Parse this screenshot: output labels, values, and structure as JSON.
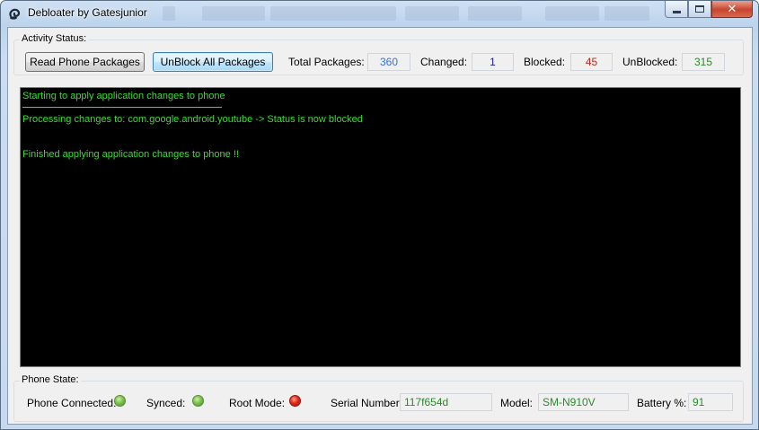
{
  "window": {
    "title": "Debloater by Gatesjunior",
    "controls": {
      "minimize": "minimize",
      "maximize": "maximize",
      "close": "✕"
    }
  },
  "activity": {
    "group_label": "Activity Status:",
    "read_button": "Read Phone Packages",
    "unblock_button": "UnBlock All Packages",
    "total_label": "Total Packages:",
    "total_value": "360",
    "changed_label": "Changed:",
    "changed_value": "1",
    "blocked_label": "Blocked:",
    "blocked_value": "45",
    "unblocked_label": "UnBlocked:",
    "unblocked_value": "315"
  },
  "console": {
    "lines": [
      "Starting to apply application changes to phone",
      "Processing changes to:  com.google.android.youtube  -> Status is now blocked",
      "Finished applying application changes to phone !!"
    ]
  },
  "phone_state": {
    "group_label": "Phone State:",
    "connected_label": "Phone Connected:",
    "connected_status": "green",
    "synced_label": "Synced:",
    "synced_status": "green",
    "root_label": "Root Mode:",
    "root_status": "red",
    "serial_label": "Serial Number:",
    "serial_value": "117f654d",
    "model_label": "Model:",
    "model_value": "SM-N910V",
    "battery_label": "Battery %:",
    "battery_value": "91"
  },
  "colors": {
    "console_text": "#35e02e",
    "total_value": "#3b6fd8",
    "changed_value": "#1a1a8a",
    "blocked_value": "#c0281c",
    "unblocked_value": "#2a8a2a",
    "state_value": "#2a8a2a",
    "led_on": "#7cc24d",
    "led_off": "#e5281a"
  }
}
